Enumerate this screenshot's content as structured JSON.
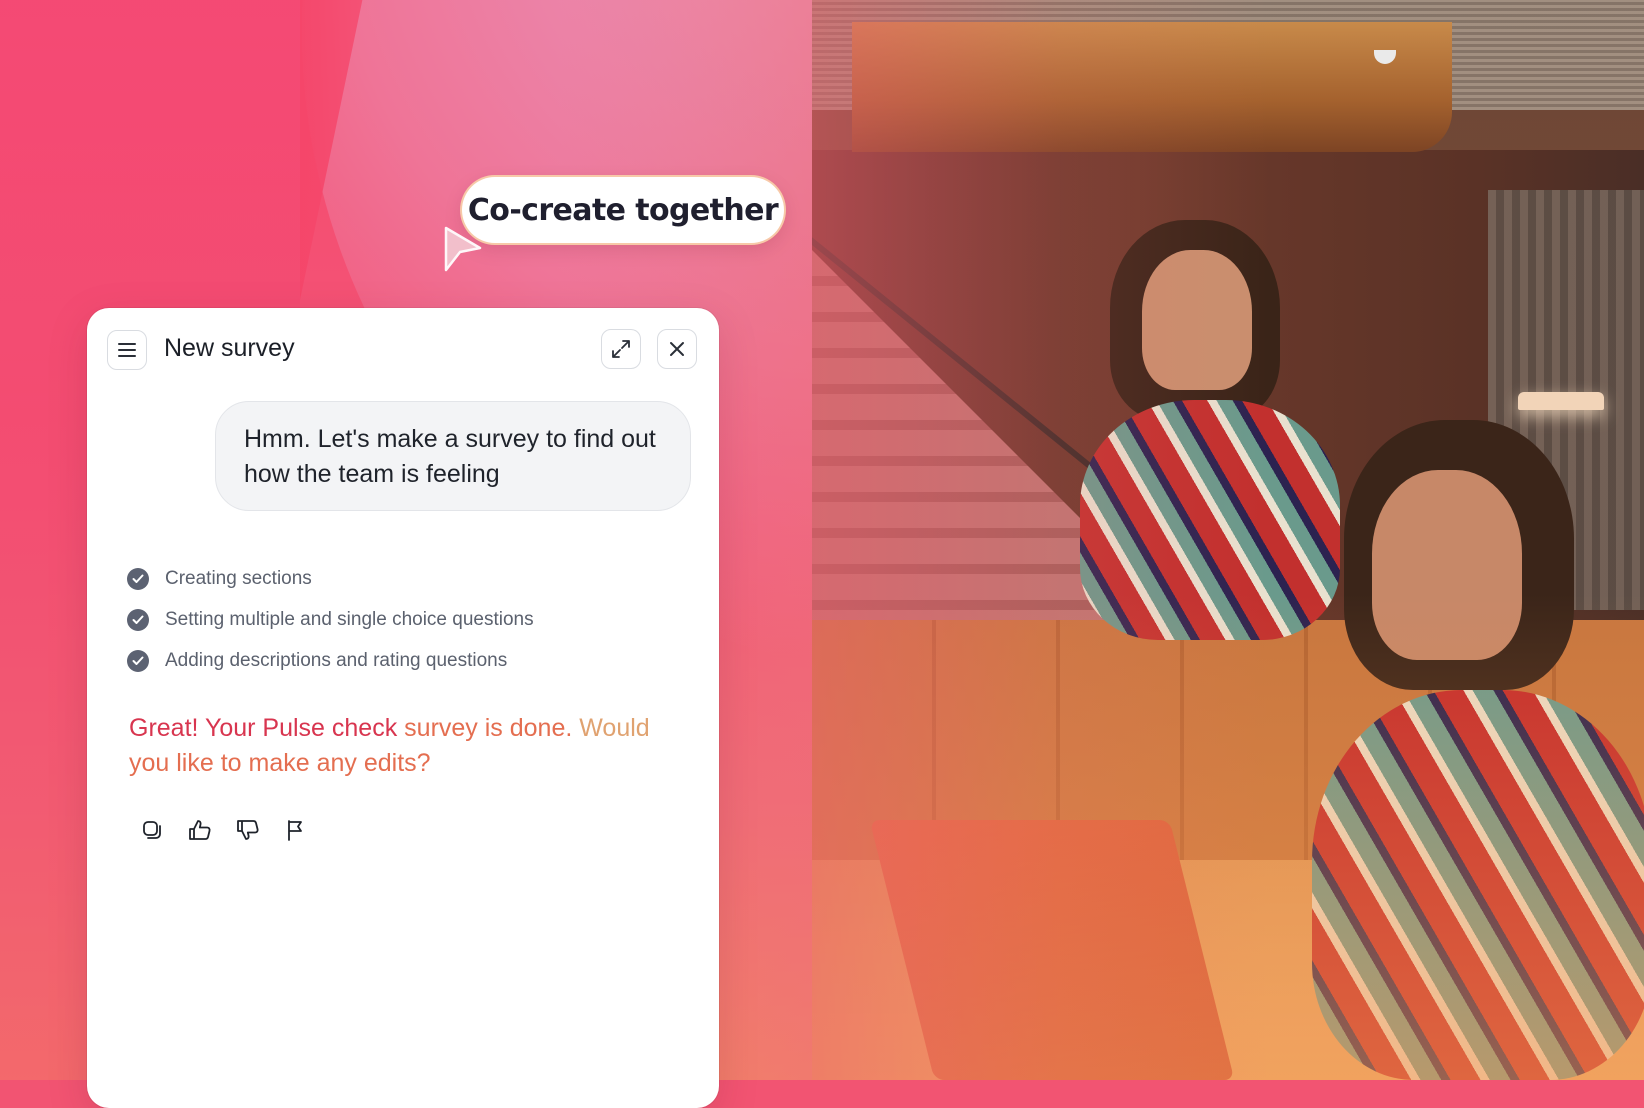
{
  "bubble": {
    "text": "Co-create together"
  },
  "chat": {
    "title": "New survey",
    "user_message": "Hmm. Let's make a survey to find out how the team is feeling",
    "steps": [
      {
        "label": "Creating sections",
        "done": true
      },
      {
        "label": "Setting multiple and single choice questions",
        "done": true
      },
      {
        "label": "Adding descriptions and rating questions",
        "done": true
      }
    ],
    "reply": {
      "part1": "Great! Your Pulse check ",
      "part2": "survey is done. ",
      "part3": "Would ",
      "part4": "you like to make any edits?"
    },
    "header_icons": [
      "menu-icon",
      "expand-icon",
      "close-icon"
    ],
    "action_icons": [
      "copy-icon",
      "thumbs-up-icon",
      "thumbs-down-icon",
      "flag-icon"
    ]
  },
  "colors": {
    "accent_pink": "#f44a6c",
    "reply_red": "#d8354f",
    "reply_orange": "#e46e50",
    "reply_tan": "#e0a270",
    "check_gray": "#5c6272"
  }
}
